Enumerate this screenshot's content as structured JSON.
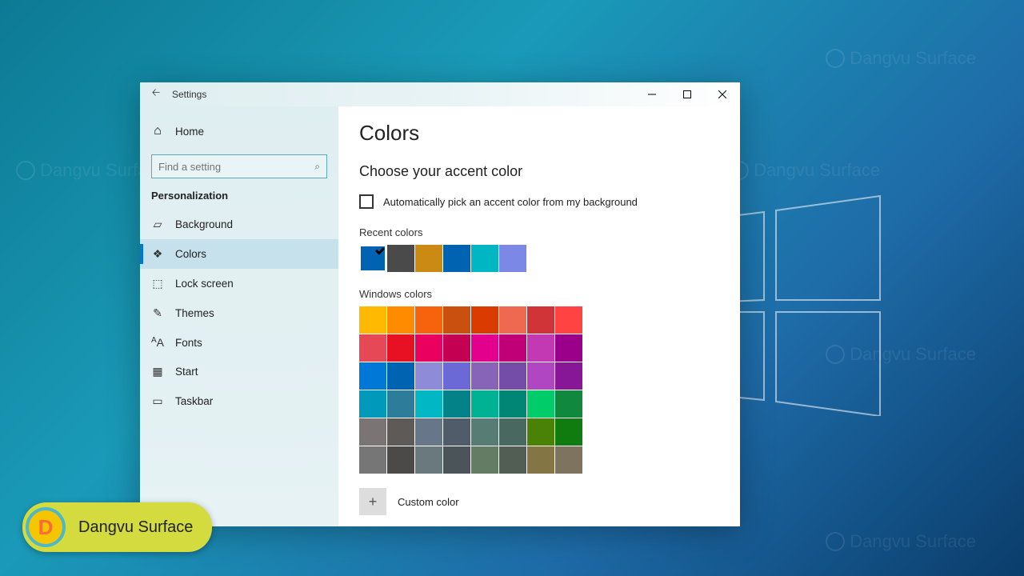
{
  "window": {
    "title": "Settings"
  },
  "sidebar": {
    "home": "Home",
    "search_placeholder": "Find a setting",
    "category": "Personalization",
    "items": [
      {
        "label": "Background"
      },
      {
        "label": "Colors"
      },
      {
        "label": "Lock screen"
      },
      {
        "label": "Themes"
      },
      {
        "label": "Fonts"
      },
      {
        "label": "Start"
      },
      {
        "label": "Taskbar"
      }
    ]
  },
  "main": {
    "page_title": "Colors",
    "section_title": "Choose your accent color",
    "checkbox_label": "Automatically pick an accent color from my background",
    "recent_label": "Recent colors",
    "recent_colors": [
      "#0063b1",
      "#4a4a4a",
      "#ca8a14",
      "#0063b1",
      "#00b6c2",
      "#7c88e6"
    ],
    "windows_label": "Windows colors",
    "windows_colors": [
      "#ffb900",
      "#ff8c00",
      "#f7630c",
      "#ca5010",
      "#da3b01",
      "#ef6950",
      "#d13438",
      "#ff4343",
      "#e74856",
      "#e81123",
      "#ea005e",
      "#c30052",
      "#e3008c",
      "#bf0077",
      "#c239b3",
      "#9a0089",
      "#0078d7",
      "#0063b1",
      "#8e8cd8",
      "#6b69d6",
      "#8764b8",
      "#744da9",
      "#b146c2",
      "#881798",
      "#0099bc",
      "#2d7d9a",
      "#00b7c3",
      "#038387",
      "#00b294",
      "#018574",
      "#00cc6a",
      "#10893e",
      "#7a7574",
      "#5d5a58",
      "#68768a",
      "#515c6b",
      "#567c73",
      "#486860",
      "#498205",
      "#107c10",
      "#767676",
      "#4c4a48",
      "#69797e",
      "#4a5459",
      "#647c64",
      "#525e54",
      "#847545",
      "#7e735f"
    ],
    "custom_label": "Custom color"
  },
  "watermark": "Dangvu Surface"
}
